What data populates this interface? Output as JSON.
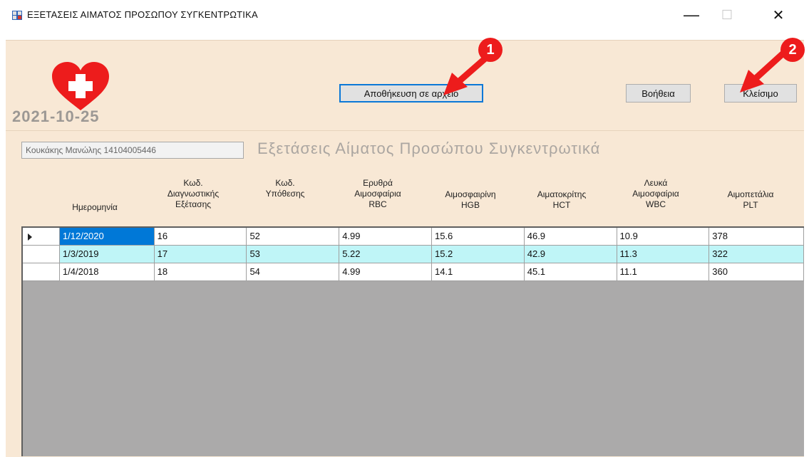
{
  "window": {
    "title": "ΕΞΕΤΑΣΕΙΣ ΑΙΜΑΤΟΣ ΠΡΟΣΩΠΟΥ ΣΥΓΚΕΝΤΡΩΤΙΚΑ",
    "minimize": "—",
    "maximize": "☐",
    "close": "✕"
  },
  "header": {
    "date": "2021-10-25",
    "save_button": "Αποθήκευση σε αρχείο",
    "help_button": "Βοήθεια",
    "close_button": "Κλείσιμο"
  },
  "patient_field": {
    "value": "Κουκάκης Μανώλης 14104005446"
  },
  "page_heading": "Εξετάσεις Αίματος Προσώπου Συγκεντρωτικά",
  "table": {
    "columns": [
      [
        "Ημερομηνία"
      ],
      [
        "Κωδ.",
        "Διαγνωστικής",
        "Εξέτασης"
      ],
      [
        "Κωδ.",
        "Υπόθεσης"
      ],
      [
        "Ερυθρά",
        "Αιμοσφαίρια",
        "RBC"
      ],
      [
        "Αιμοσφαιρίνη",
        "HGB"
      ],
      [
        "Αιματοκρίτης",
        "HCT"
      ],
      [
        "Λευκά",
        "Αιμοσφαίρια",
        "WBC"
      ],
      [
        "Αιμοπετάλια",
        "PLT"
      ]
    ],
    "rows": [
      [
        "1/12/2020",
        "16",
        "52",
        "4.99",
        "15.6",
        "46.9",
        "10.9",
        "378"
      ],
      [
        "1/3/2019",
        "17",
        "53",
        "5.22",
        "15.2",
        "42.9",
        "11.3",
        "322"
      ],
      [
        "1/4/2018",
        "18",
        "54",
        "4.99",
        "14.1",
        "45.1",
        "11.1",
        "360"
      ]
    ]
  },
  "annotations": [
    "1",
    "2"
  ],
  "colors": {
    "form_bg": "#f8e8d5",
    "alt_row": "#bff5f7",
    "selection": "#0078d7",
    "badge": "#ed1c1c"
  }
}
